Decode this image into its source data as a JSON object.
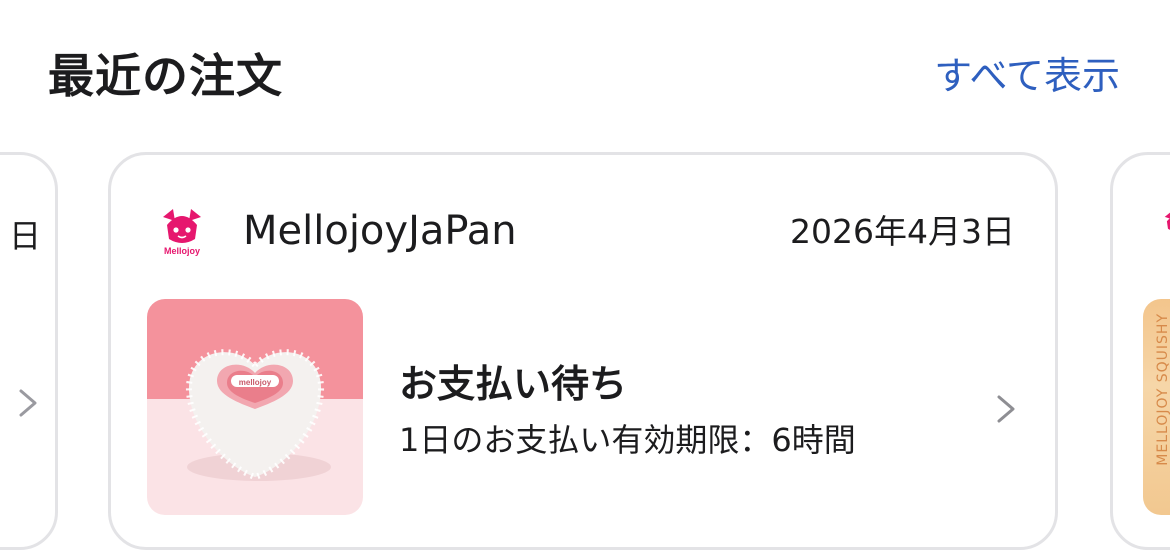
{
  "section": {
    "title": "最近の注文",
    "view_all_label": "すべて表示"
  },
  "left_peek_card": {
    "date_fragment": "日",
    "chevron_icon": "chevron-right-icon"
  },
  "order_card": {
    "shop_name": "MellojoyJaPan",
    "logo_text": "Mellojoy",
    "date": "2026年4月3日",
    "product_text": "mellojoy",
    "status": "お支払い待ち",
    "deadline": "1日のお支払い有効期限：6時間",
    "chevron_icon": "chevron-right-icon"
  },
  "right_peek_card": {
    "product_text": "MELLOJOY SQUISHY"
  },
  "colors": {
    "accent_link": "#2e5fbf",
    "brand_pink": "#e6176e",
    "card_border": "#e3e3e6",
    "thumb_top": "#f4929c",
    "thumb_bottom": "#fbe3e6"
  }
}
